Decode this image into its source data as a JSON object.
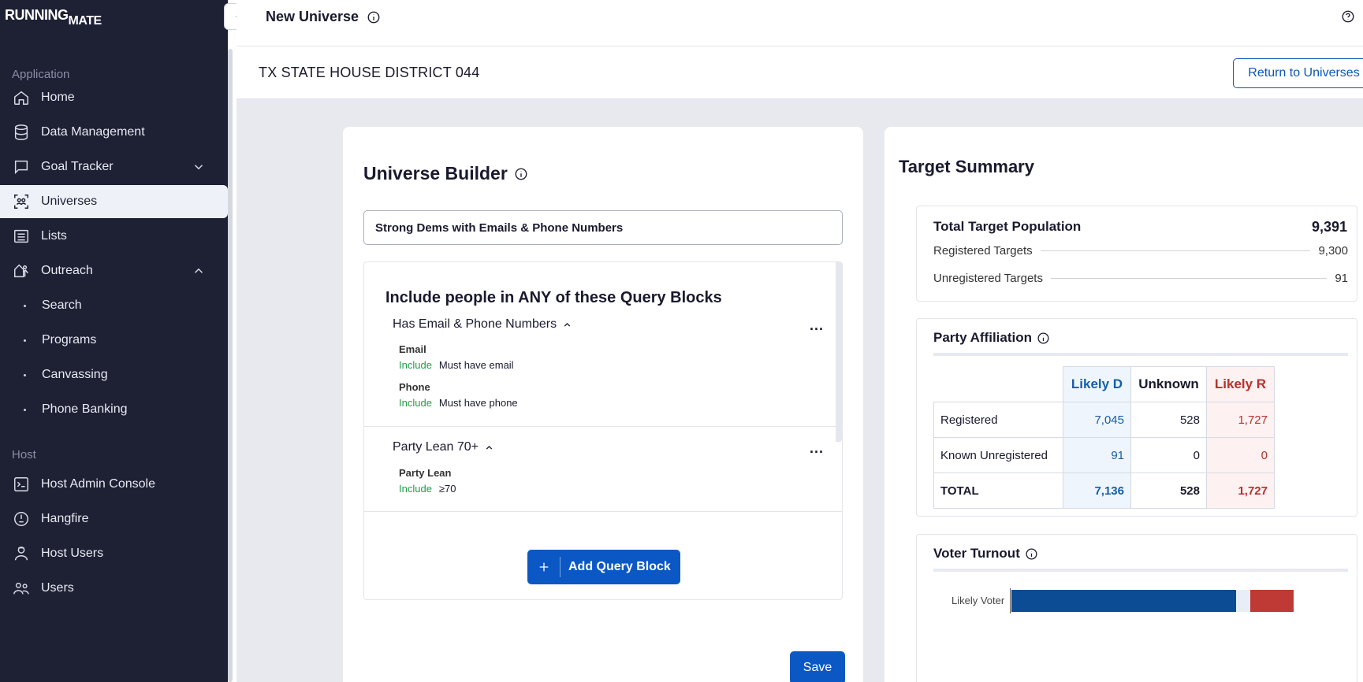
{
  "app": {
    "logo_line1": "RUNNING",
    "logo_line2": "MATE"
  },
  "sidebar": {
    "section_application": "Application",
    "section_host": "Host",
    "items": [
      {
        "label": "Home",
        "icon": "home-icon"
      },
      {
        "label": "Data Management",
        "icon": "database-icon"
      },
      {
        "label": "Goal Tracker",
        "icon": "chat-icon"
      },
      {
        "label": "Universes",
        "icon": "people-scan-icon"
      },
      {
        "label": "Lists",
        "icon": "list-icon"
      },
      {
        "label": "Outreach",
        "icon": "outreach-icon"
      }
    ],
    "sub_items": [
      "Search",
      "Programs",
      "Canvassing",
      "Phone Banking"
    ],
    "host_items": [
      {
        "label": "Host Admin Console",
        "icon": "terminal-icon"
      },
      {
        "label": "Hangfire",
        "icon": "gauge-icon"
      },
      {
        "label": "Host Users",
        "icon": "user-badge-icon"
      },
      {
        "label": "Users",
        "icon": "users-icon"
      }
    ]
  },
  "header": {
    "title": "New Universe",
    "district": "TX STATE HOUSE DISTRICT 044",
    "return_label": "Return to Universes"
  },
  "builder": {
    "title": "Universe Builder",
    "name_value": "Strong Dems with Emails & Phone Numbers",
    "heading": "Include people in ANY of these Query Blocks",
    "blocks": [
      {
        "title": "Has Email & Phone Numbers",
        "criteria": [
          {
            "label": "Email",
            "mode": "Include",
            "value": "Must have email"
          },
          {
            "label": "Phone",
            "mode": "Include",
            "value": "Must have phone"
          }
        ]
      },
      {
        "title": "Party Lean 70+",
        "criteria": [
          {
            "label": "Party Lean",
            "mode": "Include",
            "value": "≥70"
          }
        ]
      }
    ],
    "more_label": "...",
    "add_label": "Add Query Block",
    "save_label": "Save"
  },
  "summary": {
    "title": "Target Summary",
    "total_label": "Total Target Population",
    "total_value": "9,391",
    "registered_label": "Registered Targets",
    "registered_value": "9,300",
    "unregistered_label": "Unregistered Targets",
    "unregistered_value": "91",
    "party_title": "Party Affiliation",
    "party_headers": [
      "Likely D",
      "Unknown",
      "Likely R"
    ],
    "party_rows": [
      {
        "label": "Registered",
        "d": "7,045",
        "u": "528",
        "r": "1,727"
      },
      {
        "label": "Known Unregistered",
        "d": "91",
        "u": "0",
        "r": "0"
      },
      {
        "label": "TOTAL",
        "d": "7,136",
        "u": "528",
        "r": "1,727"
      }
    ],
    "turnout_title": "Voter Turnout",
    "turnout_category": "Likely Voter"
  },
  "colors": {
    "accent": "#0b58c4",
    "sidebar_bg": "#1e2034",
    "dem": "#0b4c94",
    "rep": "#c03a35",
    "include": "#1f9d4a"
  }
}
